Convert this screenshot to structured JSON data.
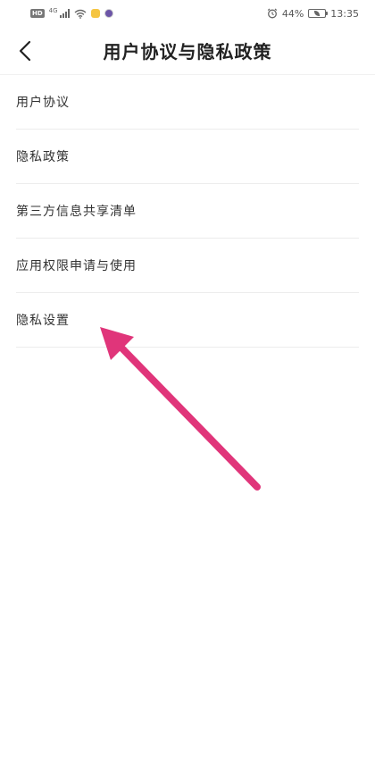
{
  "status_bar": {
    "hd": "HD",
    "network": "4G",
    "battery_percent": "44%",
    "time": "13:35"
  },
  "header": {
    "title": "用户协议与隐私政策"
  },
  "menu": {
    "items": [
      {
        "label": "用户协议"
      },
      {
        "label": "隐私政策"
      },
      {
        "label": "第三方信息共享清单"
      },
      {
        "label": "应用权限申请与使用"
      },
      {
        "label": "隐私设置"
      }
    ]
  },
  "annotation": {
    "arrow_color": "#e0357a"
  }
}
